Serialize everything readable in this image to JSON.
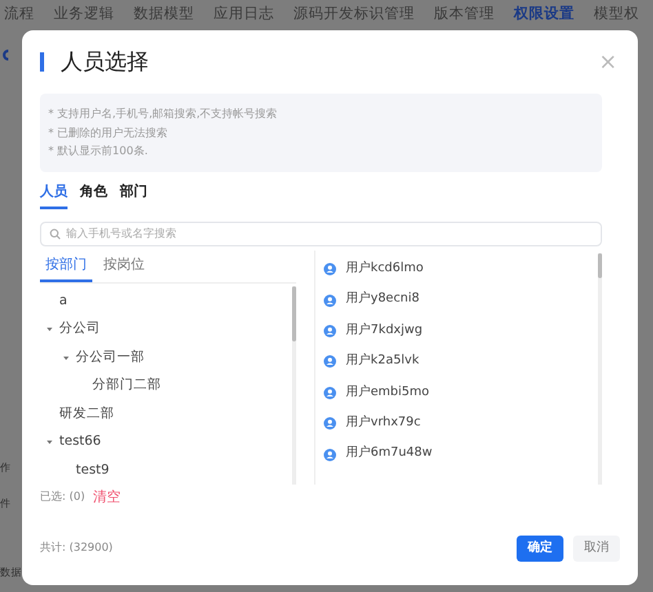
{
  "background": {
    "nav_items": [
      {
        "label": "流程",
        "selected": false
      },
      {
        "label": "业务逻辑",
        "selected": false
      },
      {
        "label": "数据模型",
        "selected": false
      },
      {
        "label": "应用日志",
        "selected": false
      },
      {
        "label": "源码开发标识管理",
        "selected": false
      },
      {
        "label": "版本管理",
        "selected": false
      },
      {
        "label": "权限设置",
        "selected": true
      },
      {
        "label": "模型权",
        "selected": false
      }
    ],
    "side_texts": [
      "作",
      "件",
      "数据"
    ]
  },
  "dialog": {
    "title": "人员选择",
    "close": "×",
    "notes": [
      "* 支持用户名,手机号,邮箱搜索,不支持帐号搜索",
      "* 已删除的用户无法搜索",
      "* 默认显示前100条."
    ],
    "tabs": [
      {
        "label": "人员",
        "selected": true
      },
      {
        "label": "角色",
        "selected": false
      },
      {
        "label": "部门",
        "selected": false
      }
    ],
    "search": {
      "placeholder": "输入手机号或名字搜索"
    },
    "sub_tabs": [
      {
        "label": "按部门",
        "selected": true
      },
      {
        "label": "按岗位",
        "selected": false
      }
    ],
    "tree": [
      {
        "label": "a"
      },
      {
        "label": "分公司",
        "expanded": true,
        "children": [
          {
            "label": "分公司一部",
            "expanded": true,
            "children": [
              {
                "label": "分部门二部"
              }
            ]
          }
        ]
      },
      {
        "label": "研发二部"
      },
      {
        "label": "test66",
        "expanded": true,
        "children": [
          {
            "label": "test9"
          }
        ]
      }
    ],
    "users": [
      "用户kcd6lmo",
      "用户y8ecni8",
      "用户7kdxjwg",
      "用户k2a5lvk",
      "用户embi5mo",
      "用户vrhx79c",
      "用户6m7u48w"
    ],
    "selected_label": "已选: (0)",
    "clear": "清空",
    "total": "共计: (32900)",
    "buttons": [
      {
        "label": "确定",
        "kind": "primary"
      },
      {
        "label": "取消",
        "kind": "secondary"
      }
    ]
  }
}
